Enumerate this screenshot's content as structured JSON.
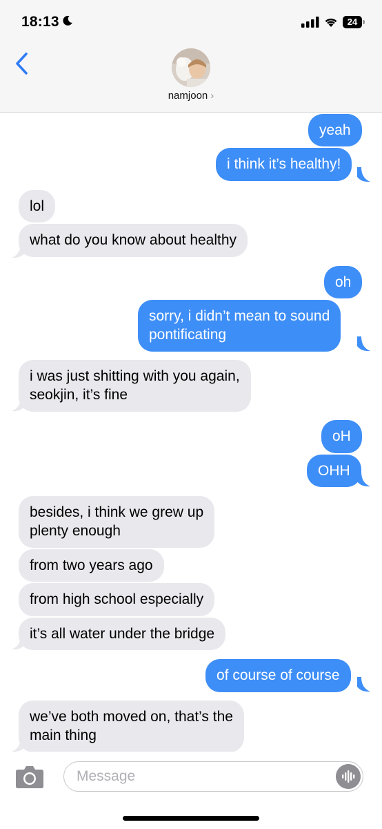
{
  "status_bar": {
    "time": "18:13",
    "battery": "24"
  },
  "header": {
    "contact_name": "namjoon",
    "chevron": "›"
  },
  "messages": [
    {
      "dir": "sent",
      "text": "yeah"
    },
    {
      "dir": "sent",
      "text": "i think it’s healthy!"
    },
    {
      "dir": "recv",
      "text": "lol"
    },
    {
      "dir": "recv",
      "text": "what do you know about healthy"
    },
    {
      "dir": "sent",
      "text": "oh"
    },
    {
      "dir": "sent",
      "line1": "sorry, i didn’t mean to sound",
      "line2": "pontificating"
    },
    {
      "dir": "recv",
      "line1": "i was just shitting with you again,",
      "line2": "seokjin, it’s fine"
    },
    {
      "dir": "sent",
      "text": "oH"
    },
    {
      "dir": "sent",
      "text": "OHH"
    },
    {
      "dir": "recv",
      "line1": "besides, i think we grew up",
      "line2": "plenty enough"
    },
    {
      "dir": "recv",
      "text": "from two years ago"
    },
    {
      "dir": "recv",
      "text": "from high school especially"
    },
    {
      "dir": "recv",
      "text": "it’s all water under the bridge"
    },
    {
      "dir": "sent",
      "text": "of course of course"
    },
    {
      "dir": "recv",
      "line1": "we’ve both moved on, that’s the",
      "line2": "main thing"
    }
  ],
  "composer": {
    "placeholder": "Message"
  },
  "icons": {
    "back": "chevron-left-icon",
    "moon": "moon-icon",
    "signal": "cellular-signal-icon",
    "wifi": "wifi-icon",
    "battery": "battery-icon",
    "camera": "camera-icon",
    "audio": "audio-waveform-icon"
  },
  "colors": {
    "sent_bubble": "#3e8ef7",
    "recv_bubble": "#e8e8ed",
    "accent": "#2f7cf6"
  }
}
